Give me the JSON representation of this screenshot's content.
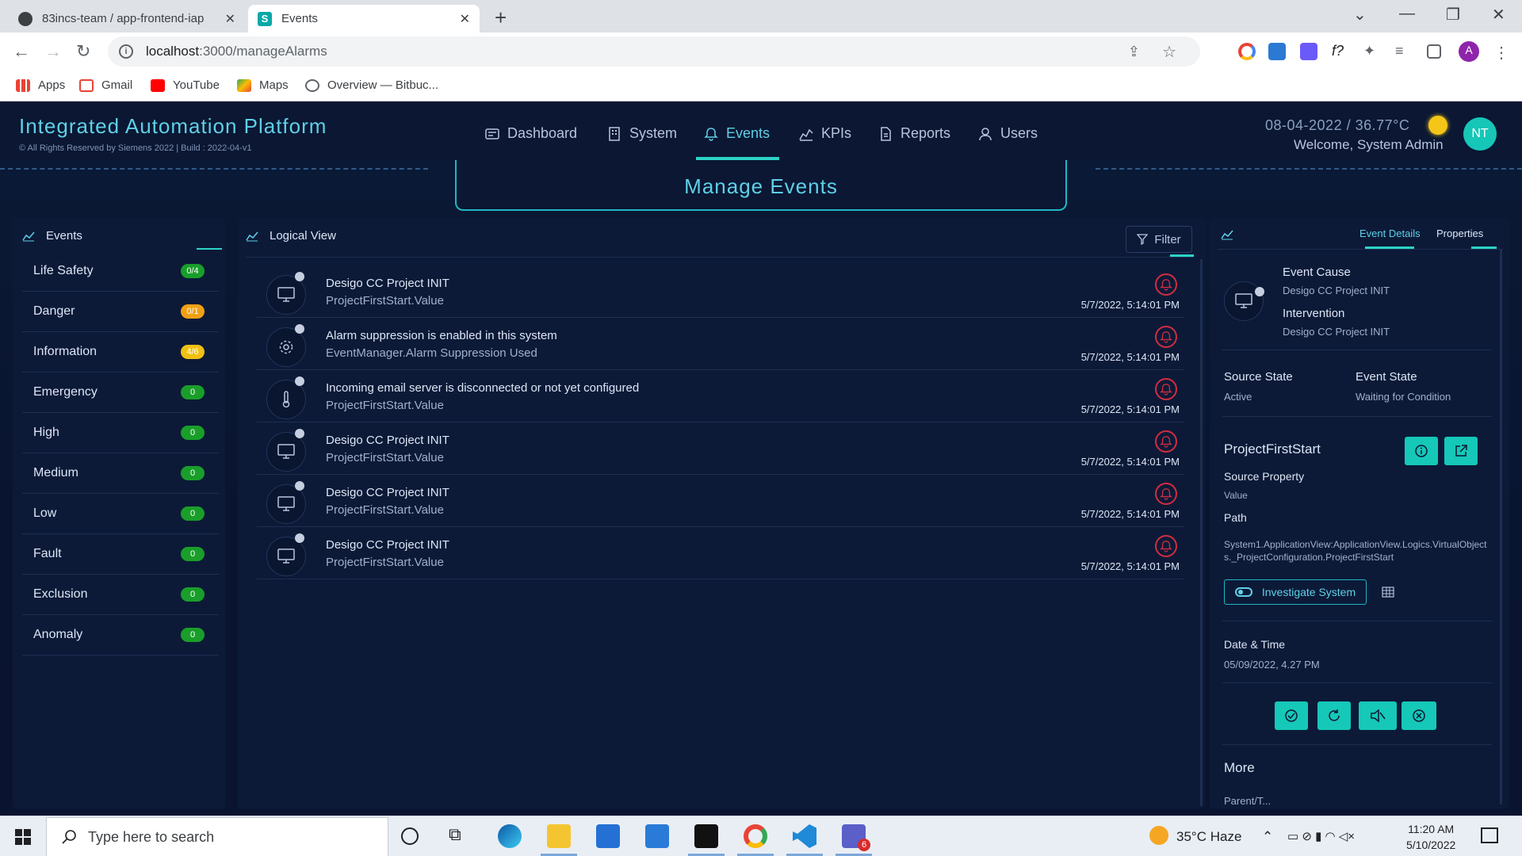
{
  "browser": {
    "tabs": [
      {
        "title": "83incs-team / app-frontend-iap",
        "active": false
      },
      {
        "title": "Events",
        "active": true
      }
    ],
    "url": "localhost:3000/manageAlarms",
    "url_host": "localhost",
    "url_rest": ":3000/manageAlarms",
    "profile_initial": "A",
    "bookmarks": [
      {
        "label": "Apps",
        "icon": "apps-grid-icon"
      },
      {
        "label": "Gmail",
        "icon": "gmail-icon"
      },
      {
        "label": "YouTube",
        "icon": "youtube-icon"
      },
      {
        "label": "Maps",
        "icon": "maps-icon"
      },
      {
        "label": "Overview — Bitbuc...",
        "icon": "globe-icon"
      }
    ]
  },
  "app": {
    "title": "Integrated Automation Platform",
    "subtitle": "© All Rights Reserved by Siemens 2022 | Build : 2022-04-v1",
    "menu": [
      {
        "label": "Dashboard",
        "icon": "dashboard-icon",
        "active": false
      },
      {
        "label": "System",
        "icon": "building-icon",
        "active": false
      },
      {
        "label": "Events",
        "icon": "bell-icon",
        "active": true
      },
      {
        "label": "KPIs",
        "icon": "kpi-chart-icon",
        "active": false
      },
      {
        "label": "Reports",
        "icon": "report-icon",
        "active": false
      },
      {
        "label": "Users",
        "icon": "user-icon",
        "active": false
      }
    ],
    "date": "08-04-2022",
    "separator": "/",
    "temperature": "36.77°C",
    "welcome": "Welcome, System Admin",
    "avatar": "NT",
    "page_title": "Manage Events",
    "accent": "#2bd4c6"
  },
  "events_panel": {
    "title": "Events",
    "items": [
      {
        "label": "Life Safety",
        "count": "0/4",
        "color": "#1a9e2a"
      },
      {
        "label": "Danger",
        "count": "0/1",
        "color": "#f0a012"
      },
      {
        "label": "Information",
        "count": "4/6",
        "color": "#f0c012"
      },
      {
        "label": "Emergency",
        "count": "0",
        "color": "#1a9e2a"
      },
      {
        "label": "High",
        "count": "0",
        "color": "#1a9e2a"
      },
      {
        "label": "Medium",
        "count": "0",
        "color": "#1a9e2a"
      },
      {
        "label": "Low",
        "count": "0",
        "color": "#1a9e2a"
      },
      {
        "label": "Fault",
        "count": "0",
        "color": "#1a9e2a"
      },
      {
        "label": "Exclusion",
        "count": "0",
        "color": "#1a9e2a"
      },
      {
        "label": "Anomaly",
        "count": "0",
        "color": "#1a9e2a"
      }
    ]
  },
  "logical_view": {
    "title": "Logical View",
    "filter_label": "Filter",
    "events": [
      {
        "title": "Desigo CC Project INIT",
        "source": "ProjectFirstStart.Value",
        "time": "5/7/2022, 5:14:01 PM",
        "icon": "monitor-icon"
      },
      {
        "title": "Alarm suppression is enabled in this system",
        "source": "EventManager.Alarm Suppression Used",
        "time": "5/7/2022, 5:14:01 PM",
        "icon": "gear-icon"
      },
      {
        "title": "Incoming email server is disconnected or not yet configured",
        "source": "ProjectFirstStart.Value",
        "time": "5/7/2022, 5:14:01 PM",
        "icon": "thermometer-icon"
      },
      {
        "title": "Desigo CC Project INIT",
        "source": "ProjectFirstStart.Value",
        "time": "5/7/2022, 5:14:01 PM",
        "icon": "monitor-icon"
      },
      {
        "title": "Desigo CC Project INIT",
        "source": "ProjectFirstStart.Value",
        "time": "5/7/2022, 5:14:01 PM",
        "icon": "monitor-icon"
      },
      {
        "title": "Desigo CC Project INIT",
        "source": "ProjectFirstStart.Value",
        "time": "5/7/2022, 5:14:01 PM",
        "icon": "monitor-icon"
      }
    ]
  },
  "details": {
    "tabs": [
      "Event Details",
      "Properties"
    ],
    "event_cause_label": "Event Cause",
    "event_cause": "Desigo CC Project INIT",
    "intervention_label": "Intervention",
    "intervention": "Desigo CC Project INIT",
    "source_state_label": "Source State",
    "source_state": "Active",
    "event_state_label": "Event State",
    "event_state": "Waiting for Condition",
    "object_name": "ProjectFirstStart",
    "source_property_label": "Source Property",
    "source_property": "Value",
    "path_label": "Path",
    "path": "System1.ApplicationView:ApplicationView.Logics.VirtualObjects._ProjectConfiguration.ProjectFirstStart",
    "investigate_label": "Investigate System",
    "datetime_label": "Date & Time",
    "datetime": "05/09/2022, 4.27 PM",
    "more_label": "More",
    "truncated_label": "Parent/T..."
  },
  "taskbar": {
    "search_placeholder": "Type here to search",
    "weather": "35°C  Haze",
    "time": "11:20 AM",
    "date": "5/10/2022",
    "teams_badge": "6"
  }
}
